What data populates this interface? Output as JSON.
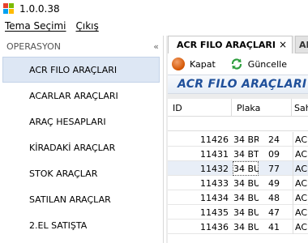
{
  "window": {
    "title": "1.0.0.38"
  },
  "menu": {
    "items": [
      "Tema Seçimi",
      "Çıkış"
    ]
  },
  "sidebar": {
    "header": "OPERASYON",
    "items": [
      {
        "label": "ACR FILO ARAÇLARI",
        "active": true
      },
      {
        "label": "ACARLAR ARAÇLARI"
      },
      {
        "label": "ARAÇ HESAPLARI"
      },
      {
        "label": "KİRADAKİ ARAÇLAR"
      },
      {
        "label": "STOK ARAÇLAR"
      },
      {
        "label": "SATILAN ARAÇLAR"
      },
      {
        "label": "2.EL SATIŞTA"
      }
    ]
  },
  "tabs": {
    "active_label": "ACR FILO ARAÇLARI",
    "close_glyph": "×",
    "inactive_label": "AR"
  },
  "toolbar": {
    "close_label": "Kapat",
    "refresh_label": "Güncelle"
  },
  "page": {
    "heading": "ACR FILO ARAÇLARI"
  },
  "grid": {
    "columns": [
      "ID",
      "Plaka",
      "Sah"
    ],
    "rows": [
      {
        "id": "11426",
        "plaka": "34 BR",
        "plaka_tail": "24",
        "sahip": "ACR"
      },
      {
        "id": "11431",
        "plaka": "34 BT",
        "plaka_tail": "09",
        "sahip": "ACR"
      },
      {
        "id": "11432",
        "plaka": "34 BU",
        "plaka_tail": "77",
        "sahip": "ACR"
      },
      {
        "id": "11433",
        "plaka": "34 BU",
        "plaka_tail": "49",
        "sahip": "ACR"
      },
      {
        "id": "11434",
        "plaka": "34 BU",
        "plaka_tail": "48",
        "sahip": "ACR"
      },
      {
        "id": "11435",
        "plaka": "34 BU",
        "plaka_tail": "47",
        "sahip": "ACR"
      },
      {
        "id": "11436",
        "plaka": "34 BU",
        "plaka_tail": "41",
        "sahip": "ACR"
      }
    ]
  },
  "colors": {
    "accent": "#1f4f9a",
    "selected_row": "#e8eef7",
    "sidebar_active": "#dde7f4",
    "close_button": "#d35400",
    "refresh_icon": "#2e9e3e"
  },
  "icons": {
    "app": "app-logo-icon",
    "collapse": "collapse-left-icon",
    "close": "close-circle-icon",
    "refresh": "refresh-icon"
  }
}
